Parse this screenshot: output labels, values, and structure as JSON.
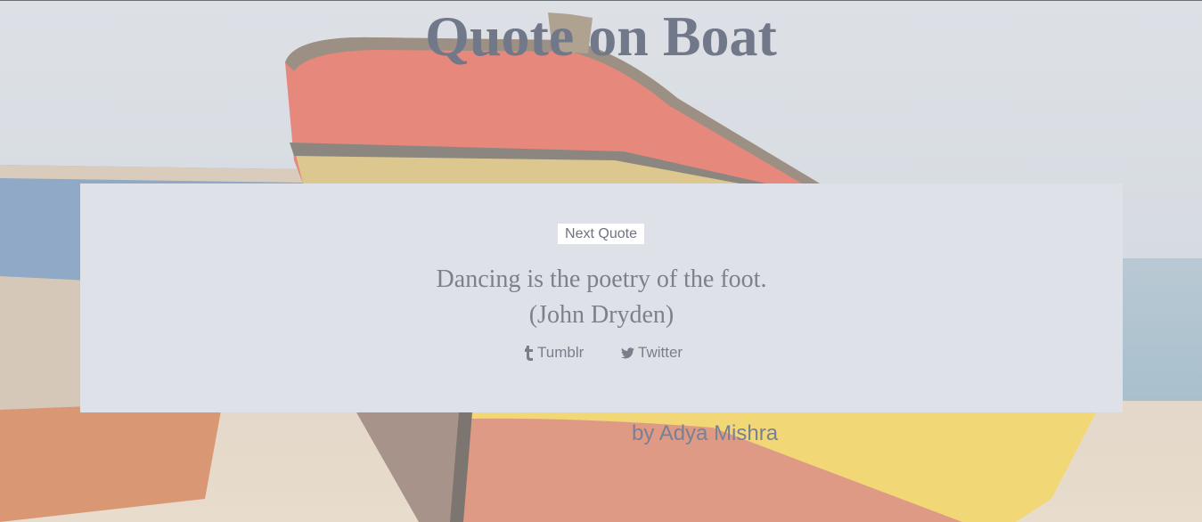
{
  "page": {
    "title": "Quote on Boat",
    "byline": "by Adya Mishra"
  },
  "quote": {
    "text": "Dancing is the poetry of the foot.",
    "author": "(John Dryden)",
    "next_label": "Next Quote"
  },
  "share": {
    "tumblr_label": "Tumblr",
    "twitter_label": "Twitter",
    "tumblr_icon": "tumblr-icon",
    "twitter_icon": "twitter-icon"
  },
  "colors": {
    "title": "#717889",
    "panel": "#dee2e8",
    "text": "#7c808c",
    "boat_red": "#e97a6c",
    "boat_yellow": "#f2d777"
  }
}
